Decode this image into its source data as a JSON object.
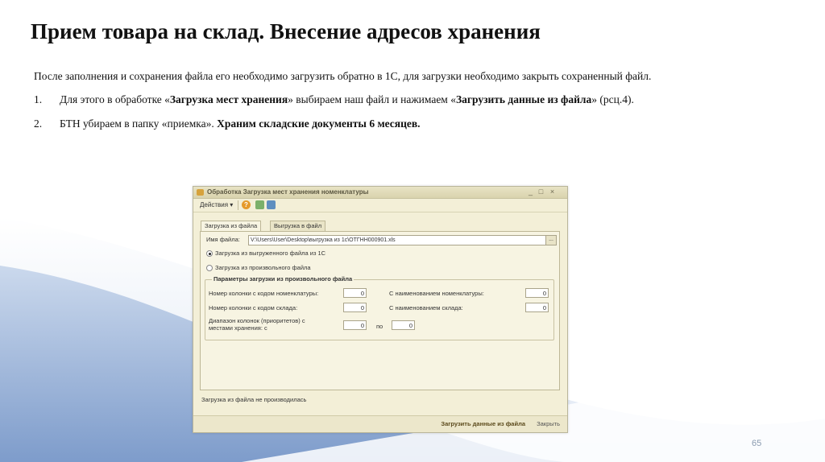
{
  "slide": {
    "title": "Прием товара на склад. Внесение адресов хранения",
    "intro": "После заполнения и сохранения файла его необходимо загрузить обратно в 1С, для загрузки необходимо закрыть сохраненный файл.",
    "steps": [
      {
        "num": "1.",
        "text1": "Для этого в обработке «",
        "bold1": "Загрузка мест хранения",
        "text2": "» выбираем наш файл и нажимаем «",
        "bold2": "Загрузить данные из файла",
        "text3": "» (рсц.4)."
      },
      {
        "num": "2.",
        "text1": "БТН убираем в папку «приемка». ",
        "bold1": "Храним складские документы 6 месяцев."
      }
    ],
    "page_number": "65"
  },
  "window": {
    "title": "Обработка  Загрузка мест хранения номенклатуры",
    "controls": {
      "minimize": "_",
      "maximize": "□",
      "close": "×"
    },
    "toolbar": {
      "actions_label": "Действия ▾",
      "help_icon": "?"
    },
    "tabs": [
      {
        "label": "Загрузка из файла",
        "active": true
      },
      {
        "label": "Выгрузка в файл",
        "active": false
      }
    ],
    "file_label": "Имя файла:",
    "file_value": "V:\\Users\\User\\Desktop\\выгрузка из 1с\\ОТГНН000901.xls",
    "file_button": "...",
    "radio_options": [
      {
        "label": "Загрузка из выгруженного файла из 1С",
        "selected": true
      },
      {
        "label": "Загрузка из произвольного файла",
        "selected": false
      }
    ],
    "params": {
      "title": "Параметры загрузки из произвольного файла",
      "row1_left_label": "Номер колонки с кодом номенклатуры:",
      "row1_left_value": "0",
      "row1_right_label": "С наименованием номенклатуры:",
      "row1_right_value": "0",
      "row2_left_label": "Номер колонки с кодом склада:",
      "row2_left_value": "0",
      "row2_right_label": "С наименованием склада:",
      "row2_right_value": "0",
      "range_label_line1": "Диапазон колонок (приоритетов) с",
      "range_label_line2": "местами хранения: с",
      "range_from": "0",
      "range_to_label": "по",
      "range_to": "0"
    },
    "status_text": "Загрузка из файла не производилась",
    "buttons": {
      "load": "Загрузить данные из файла",
      "close": "Закрыть"
    }
  }
}
